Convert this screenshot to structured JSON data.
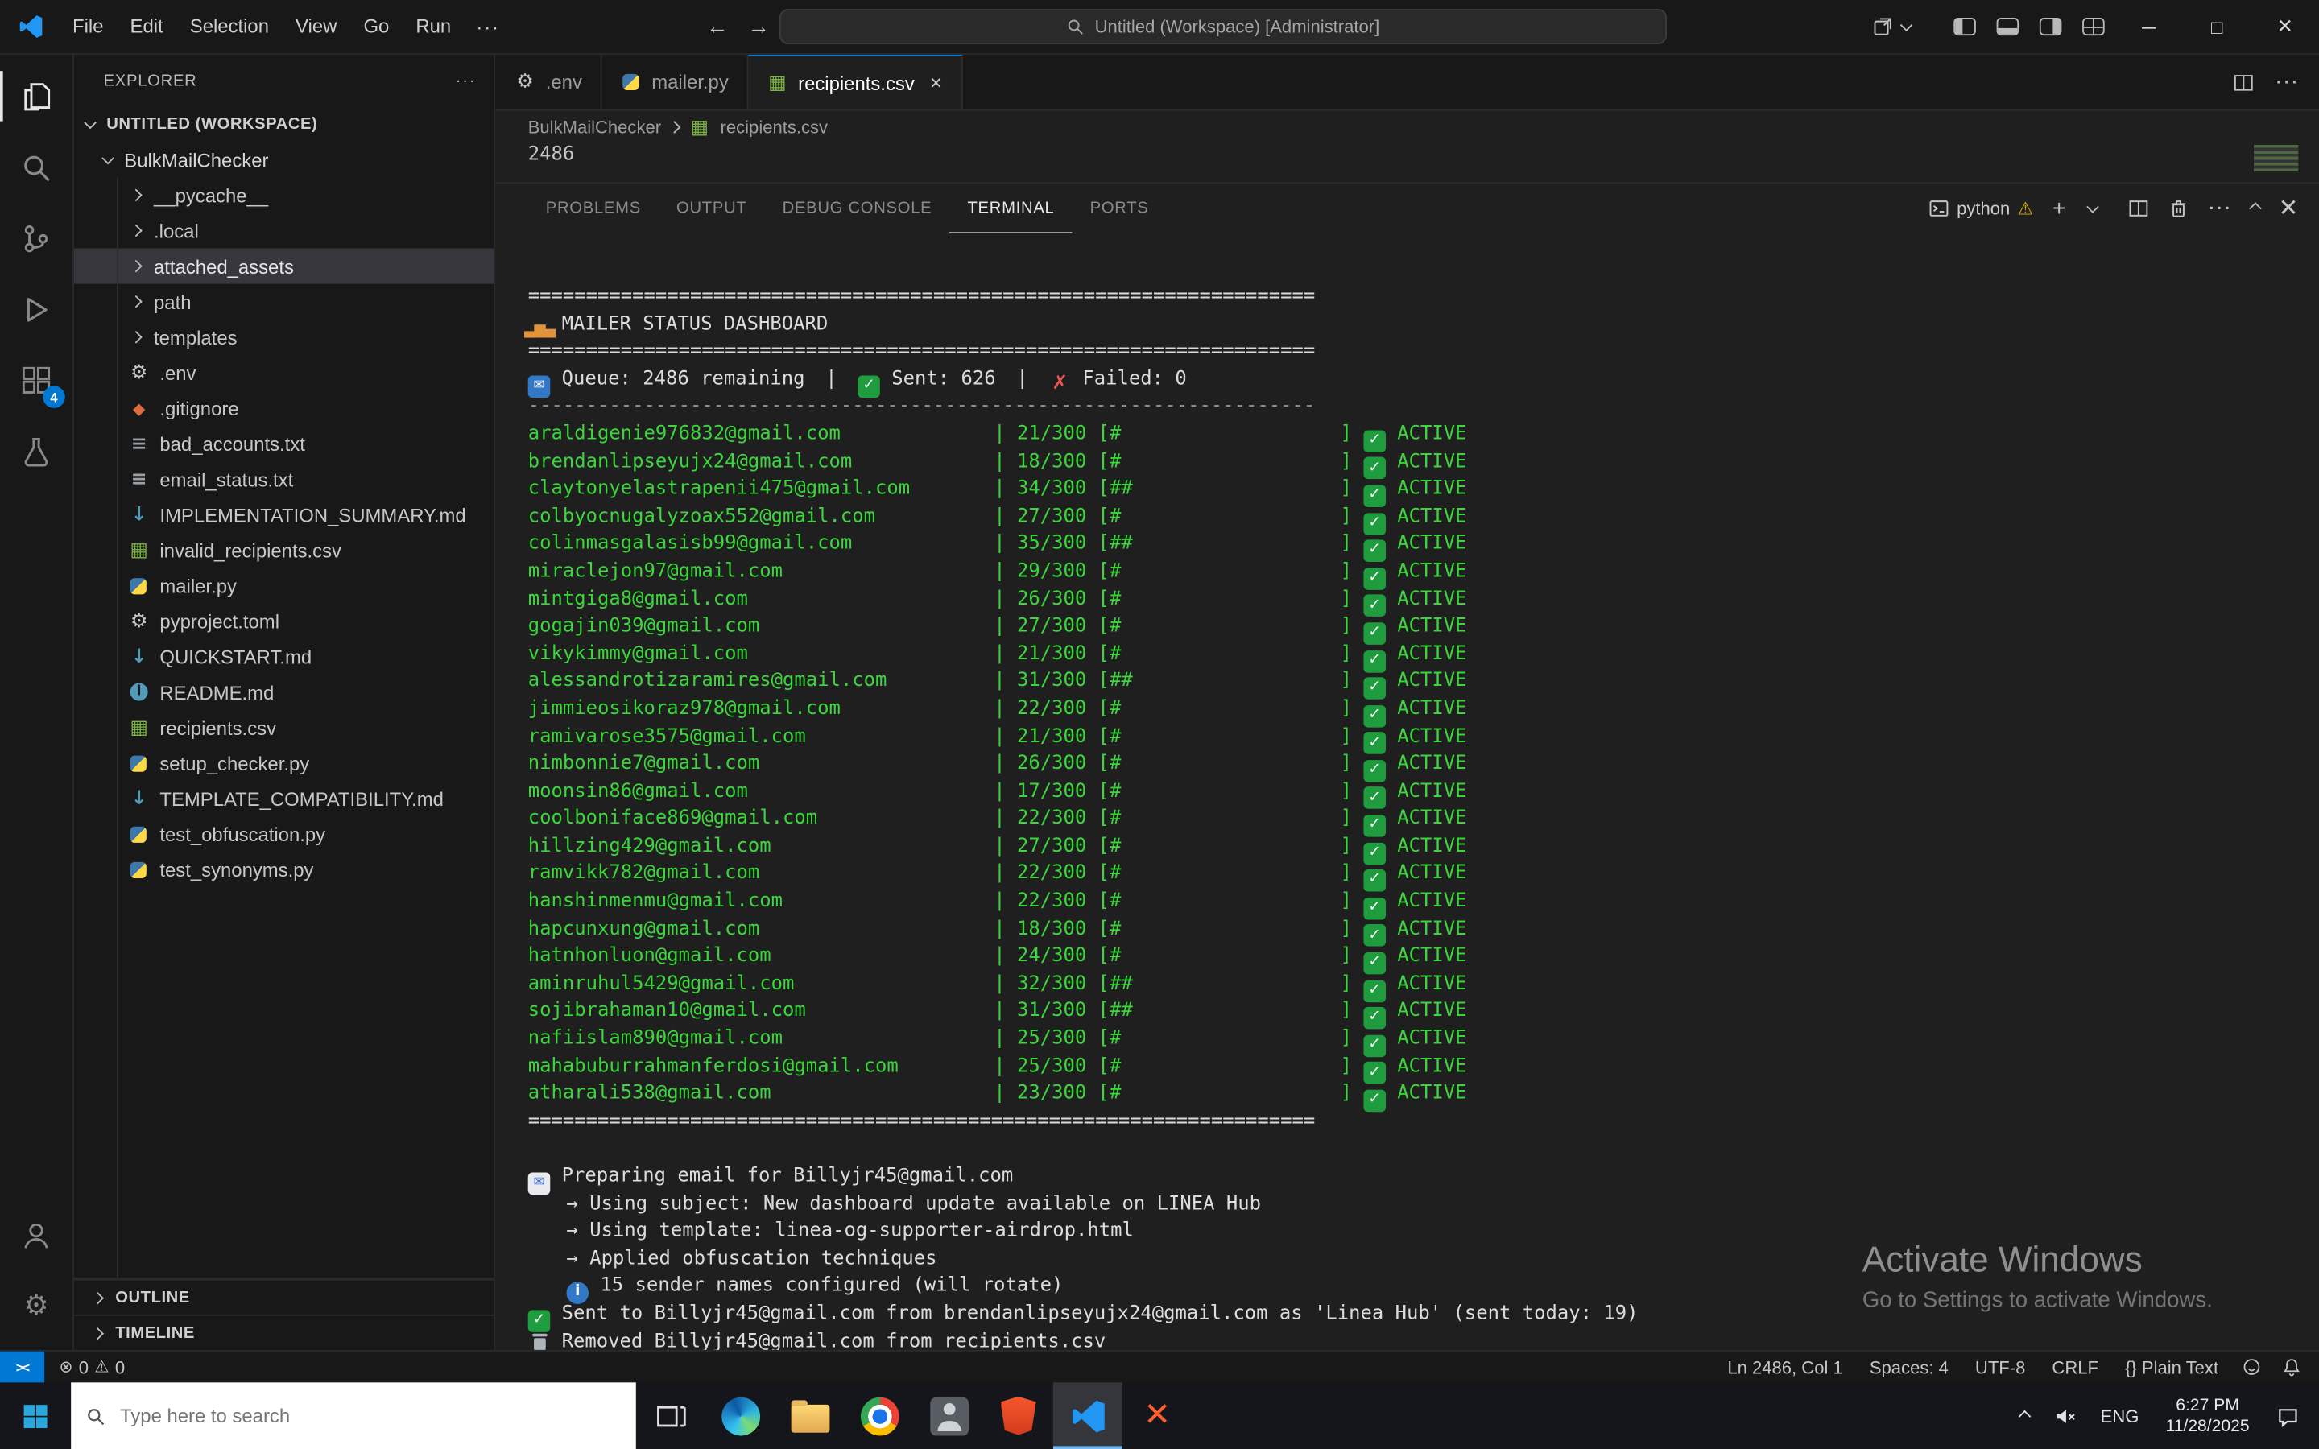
{
  "titlebar": {
    "menus": [
      "File",
      "Edit",
      "Selection",
      "View",
      "Go",
      "Run"
    ],
    "search_label": "Untitled (Workspace) [Administrator]"
  },
  "glyphs": {
    "back": "←",
    "forward": "→",
    "more": "···",
    "minimize": "─",
    "maximize": "□",
    "close": "✕",
    "plus": "+",
    "warning": "⚠",
    "gear": "⚙",
    "error": "⊗",
    "remote": "><"
  },
  "activity_bar": {
    "extensions_badge": "4"
  },
  "explorer": {
    "header": "EXPLORER",
    "workspace_label": "UNTITLED (WORKSPACE)",
    "root_folder": "BulkMailChecker",
    "items": [
      {
        "label": "__pycache__",
        "icon": "folder"
      },
      {
        "label": ".local",
        "icon": "folder"
      },
      {
        "label": "attached_assets",
        "icon": "folder",
        "selected": true
      },
      {
        "label": "path",
        "icon": "folder"
      },
      {
        "label": "templates",
        "icon": "folder"
      },
      {
        "label": ".env",
        "icon": "gear"
      },
      {
        "label": ".gitignore",
        "icon": "git"
      },
      {
        "label": "bad_accounts.txt",
        "icon": "txt"
      },
      {
        "label": "email_status.txt",
        "icon": "txt"
      },
      {
        "label": "IMPLEMENTATION_SUMMARY.md",
        "icon": "md"
      },
      {
        "label": "invalid_recipients.csv",
        "icon": "csv"
      },
      {
        "label": "mailer.py",
        "icon": "py"
      },
      {
        "label": "pyproject.toml",
        "icon": "gear"
      },
      {
        "label": "QUICKSTART.md",
        "icon": "md"
      },
      {
        "label": "README.md",
        "icon": "info"
      },
      {
        "label": "recipients.csv",
        "icon": "csv"
      },
      {
        "label": "setup_checker.py",
        "icon": "py"
      },
      {
        "label": "TEMPLATE_COMPATIBILITY.md",
        "icon": "md"
      },
      {
        "label": "test_obfuscation.py",
        "icon": "py"
      },
      {
        "label": "test_synonyms.py",
        "icon": "py"
      }
    ],
    "sections": [
      "OUTLINE",
      "TIMELINE"
    ]
  },
  "tabs": [
    {
      "label": ".env",
      "icon": "gear",
      "active": false
    },
    {
      "label": "mailer.py",
      "icon": "py",
      "active": false
    },
    {
      "label": "recipients.csv",
      "icon": "csv",
      "active": true
    }
  ],
  "breadcrumb": {
    "folder": "BulkMailChecker",
    "file": "recipients.csv"
  },
  "editor": {
    "visible_line": "2486"
  },
  "panel": {
    "tabs": [
      {
        "label": "PROBLEMS"
      },
      {
        "label": "OUTPUT"
      },
      {
        "label": "DEBUG CONSOLE"
      },
      {
        "label": "TERMINAL",
        "active": true
      },
      {
        "label": "PORTS"
      }
    ],
    "terminal_badge": "python"
  },
  "terminal": {
    "divider_heavy_char": "=",
    "divider_light_char": "-",
    "divider_length": 68,
    "title": "MAILER STATUS DASHBOARD",
    "queue_label": "Queue: 2486 remaining",
    "sent_label": "Sent: 626",
    "failed_label": "Failed: 0",
    "accounts": [
      {
        "email": "araldigenie976832@gmail.com",
        "progress": "21/300",
        "bar": "#",
        "status": "ACTIVE"
      },
      {
        "email": "brendanlipseyujx24@gmail.com",
        "progress": "18/300",
        "bar": "#",
        "status": "ACTIVE"
      },
      {
        "email": "claytonyelastrapenii475@gmail.com",
        "progress": "34/300",
        "bar": "##",
        "status": "ACTIVE"
      },
      {
        "email": "colbyocnugalyzoax552@gmail.com",
        "progress": "27/300",
        "bar": "#",
        "status": "ACTIVE"
      },
      {
        "email": "colinmasgalasisb99@gmail.com",
        "progress": "35/300",
        "bar": "##",
        "status": "ACTIVE"
      },
      {
        "email": "miraclejon97@gmail.com",
        "progress": "29/300",
        "bar": "#",
        "status": "ACTIVE"
      },
      {
        "email": "mintgiga8@gmail.com",
        "progress": "26/300",
        "bar": "#",
        "status": "ACTIVE"
      },
      {
        "email": "gogajin039@gmail.com",
        "progress": "27/300",
        "bar": "#",
        "status": "ACTIVE"
      },
      {
        "email": "vikykimmy@gmail.com",
        "progress": "21/300",
        "bar": "#",
        "status": "ACTIVE"
      },
      {
        "email": "alessandrotizaramires@gmail.com",
        "progress": "31/300",
        "bar": "##",
        "status": "ACTIVE"
      },
      {
        "email": "jimmieosikoraz978@gmail.com",
        "progress": "22/300",
        "bar": "#",
        "status": "ACTIVE"
      },
      {
        "email": "ramivarose3575@gmail.com",
        "progress": "21/300",
        "bar": "#",
        "status": "ACTIVE"
      },
      {
        "email": "nimbonnie7@gmail.com",
        "progress": "26/300",
        "bar": "#",
        "status": "ACTIVE"
      },
      {
        "email": "moonsin86@gmail.com",
        "progress": "17/300",
        "bar": "#",
        "status": "ACTIVE"
      },
      {
        "email": "coolboniface869@gmail.com",
        "progress": "22/300",
        "bar": "#",
        "status": "ACTIVE"
      },
      {
        "email": "hillzing429@gmail.com",
        "progress": "27/300",
        "bar": "#",
        "status": "ACTIVE"
      },
      {
        "email": "ramvikk782@gmail.com",
        "progress": "22/300",
        "bar": "#",
        "status": "ACTIVE"
      },
      {
        "email": "hanshinmenmu@gmail.com",
        "progress": "22/300",
        "bar": "#",
        "status": "ACTIVE"
      },
      {
        "email": "hapcunxung@gmail.com",
        "progress": "18/300",
        "bar": "#",
        "status": "ACTIVE"
      },
      {
        "email": "hatnhonluon@gmail.com",
        "progress": "24/300",
        "bar": "#",
        "status": "ACTIVE"
      },
      {
        "email": "aminruhul5429@gmail.com",
        "progress": "32/300",
        "bar": "##",
        "status": "ACTIVE"
      },
      {
        "email": "sojibrahaman10@gmail.com",
        "progress": "31/300",
        "bar": "##",
        "status": "ACTIVE"
      },
      {
        "email": "nafiislam890@gmail.com",
        "progress": "25/300",
        "bar": "#",
        "status": "ACTIVE"
      },
      {
        "email": "mahabuburrahmanferdosi@gmail.com",
        "progress": "25/300",
        "bar": "#",
        "status": "ACTIVE"
      },
      {
        "email": "atharali538@gmail.com",
        "progress": "23/300",
        "bar": "#",
        "status": "ACTIVE"
      }
    ],
    "log": [
      {
        "icon": "mail",
        "text": "Preparing email for Billyjr45@gmail.com"
      },
      {
        "icon": "none",
        "indent": 1,
        "text": "→ Using subject: New dashboard update available on LINEA Hub"
      },
      {
        "icon": "none",
        "indent": 1,
        "text": "→ Using template: linea-og-supporter-airdrop.html"
      },
      {
        "icon": "none",
        "indent": 1,
        "text": "→ Applied obfuscation techniques"
      },
      {
        "icon": "info",
        "indent": 1,
        "text": "15 sender names configured (will rotate)"
      },
      {
        "icon": "check",
        "text": "Sent to Billyjr45@gmail.com from brendanlipseyujx24@gmail.com as 'Linea Hub' (sent today: 19)"
      },
      {
        "icon": "trash",
        "text": "Removed Billyjr45@gmail.com from recipients.csv"
      }
    ]
  },
  "status_bar": {
    "errors": "0",
    "warnings": "0",
    "items": [
      {
        "name": "cursor-position",
        "label": "Ln 2486, Col 1"
      },
      {
        "name": "indentation",
        "label": "Spaces: 4"
      },
      {
        "name": "encoding",
        "label": "UTF-8"
      },
      {
        "name": "eol",
        "label": "CRLF"
      },
      {
        "name": "language-mode",
        "label": "{} Plain Text"
      }
    ]
  },
  "taskbar": {
    "search_placeholder": "Type here to search",
    "language": "ENG",
    "time": "6:27 PM",
    "date": "11/28/2025"
  },
  "watermark": {
    "title": "Activate Windows",
    "subtitle": "Go to Settings to activate Windows."
  }
}
